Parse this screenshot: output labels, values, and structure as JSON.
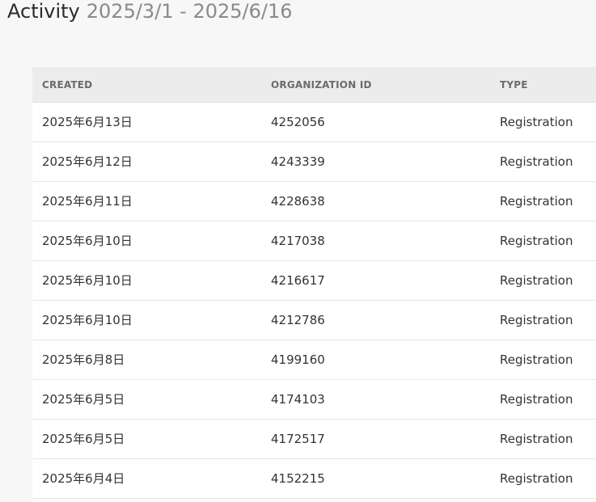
{
  "header": {
    "title": "Activity",
    "date_range": "2025/3/1 - 2025/6/16"
  },
  "table": {
    "columns": [
      "CREATED",
      "ORGANIZATION ID",
      "TYPE"
    ],
    "rows": [
      {
        "created": "2025年6月13日",
        "organization_id": "4252056",
        "type": "Registration"
      },
      {
        "created": "2025年6月12日",
        "organization_id": "4243339",
        "type": "Registration"
      },
      {
        "created": "2025年6月11日",
        "organization_id": "4228638",
        "type": "Registration"
      },
      {
        "created": "2025年6月10日",
        "organization_id": "4217038",
        "type": "Registration"
      },
      {
        "created": "2025年6月10日",
        "organization_id": "4216617",
        "type": "Registration"
      },
      {
        "created": "2025年6月10日",
        "organization_id": "4212786",
        "type": "Registration"
      },
      {
        "created": "2025年6月8日",
        "organization_id": "4199160",
        "type": "Registration"
      },
      {
        "created": "2025年6月5日",
        "organization_id": "4174103",
        "type": "Registration"
      },
      {
        "created": "2025年6月5日",
        "organization_id": "4172517",
        "type": "Registration"
      },
      {
        "created": "2025年6月4日",
        "organization_id": "4152215",
        "type": "Registration"
      }
    ]
  }
}
